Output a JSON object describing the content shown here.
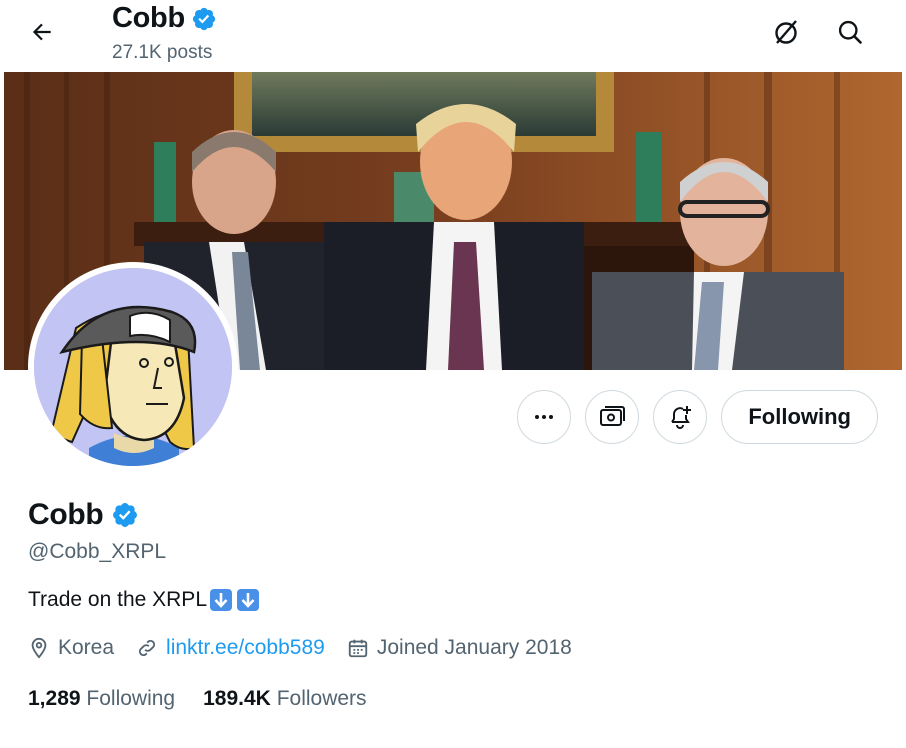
{
  "header": {
    "title": "Cobb",
    "posts_count": "27.1K posts"
  },
  "icons": {
    "back": "arrow-left-icon",
    "grok": "slash-circle-icon",
    "search": "search-icon",
    "more": "more-dots-icon",
    "subscribe": "money-icon",
    "notify": "bell-plus-icon",
    "verified": "verified-badge-icon",
    "location": "location-pin-icon",
    "link": "link-icon",
    "calendar": "calendar-icon"
  },
  "actions": {
    "following_label": "Following"
  },
  "profile": {
    "display_name": "Cobb",
    "handle": "@Cobb_XRPL",
    "bio": "Trade on the XRPL",
    "location": "Korea",
    "website": "linktr.ee/cobb589",
    "joined": "Joined January 2018"
  },
  "stats": {
    "following_count": "1,289",
    "following_label": "Following",
    "followers_count": "189.4K",
    "followers_label": "Followers"
  },
  "colors": {
    "verified": "#1d9bf0",
    "link": "#1d9bf0",
    "secondary_text": "#536471",
    "avatar_bg": "#c2c4f3"
  }
}
